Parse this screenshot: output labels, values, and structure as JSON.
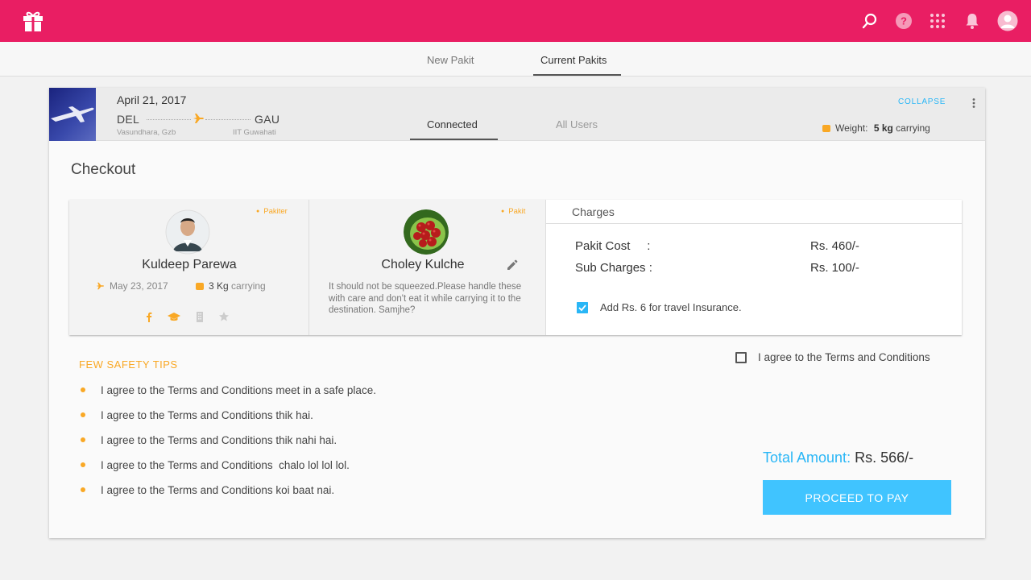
{
  "topbar": {
    "icons": [
      "gift-icon",
      "search-icon",
      "help-icon",
      "apps-grid-icon",
      "bell-icon",
      "user-avatar"
    ],
    "color": "#e91e63"
  },
  "nav": {
    "tabs": [
      {
        "label": "New Pakit",
        "active": false
      },
      {
        "label": "Current Pakits",
        "active": true
      }
    ]
  },
  "trip": {
    "date": "April 21, 2017",
    "from_code": "DEL",
    "from_place": "Vasundhara, Gzb",
    "to_code": "GAU",
    "to_place": "IIT Guwahati",
    "tabs": [
      {
        "label": "Connected",
        "active": true
      },
      {
        "label": "All Users",
        "active": false
      }
    ],
    "collapse_label": "COLLAPSE",
    "weight_label": "Weight:",
    "weight_value": "5 kg",
    "weight_suffix": "carrying"
  },
  "checkout": {
    "title": "Checkout",
    "pakiter": {
      "tag": "Pakiter",
      "name": "Kuldeep Parewa",
      "date": "May 23, 2017",
      "carry_value": "3 Kg",
      "carry_suffix": "carrying",
      "social_icons": [
        "facebook-icon",
        "education-icon",
        "building-icon",
        "star-icon"
      ]
    },
    "pakit": {
      "tag": "Pakit",
      "name": "Choley Kulche",
      "description": "It should not be squeezed.Please handle these with care and don't eat it while carrying it to the destination. Samjhe?"
    },
    "charges": {
      "title": "Charges",
      "rows": [
        {
          "label": "Pakit Cost     :",
          "value": "Rs. 460/-"
        },
        {
          "label": "Sub Charges :",
          "value": "Rs. 100/-"
        }
      ],
      "insurance_label": "Add Rs. 6 for travel Insurance.",
      "insurance_checked": true
    },
    "safety_title": "FEW SAFETY TIPS",
    "tips": [
      "I agree to the Terms and Conditions meet in a safe place.",
      "I agree to the Terms and Conditions thik hai.",
      "I agree to the Terms and Conditions thik nahi hai.",
      "I agree to the Terms and Conditions  chalo lol lol lol.",
      "I agree to the Terms and Conditions koi baat nai."
    ],
    "terms_label": "I agree to the Terms and Conditions",
    "terms_checked": false,
    "total_label": "Total Amount:",
    "total_value": "Rs. 566/-",
    "pay_button": "PROCEED TO PAY",
    "accent_blue": "#29b6f6",
    "accent_yellow": "#f9a825"
  }
}
